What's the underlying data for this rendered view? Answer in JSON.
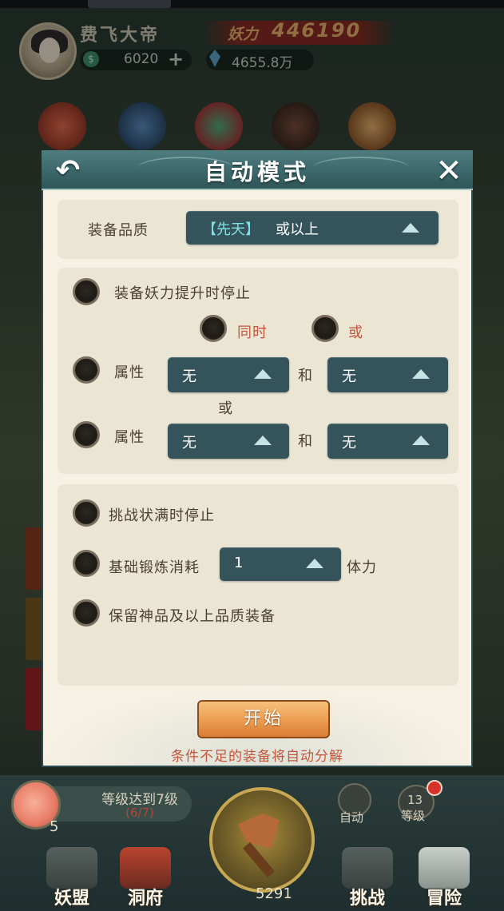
{
  "player": {
    "name": "费飞大帝",
    "power_label": "妖力",
    "power_value": "446190",
    "jade": "6020",
    "jade_plus": "+",
    "crystal": "4655.8万"
  },
  "modal": {
    "title": "自动模式",
    "back_icon": "back-arrow-icon",
    "close_icon": "close-x-icon",
    "quality": {
      "label": "装备品质",
      "selected_bracket": "【先天】",
      "selected_suffix": "或以上"
    },
    "stop_on_power": {
      "label": "装备妖力提升时停止",
      "mode_and": "同时",
      "mode_or": "或"
    },
    "attr_row_1": {
      "label": "属性",
      "first_value": "无",
      "joiner": "和",
      "second_value": "无"
    },
    "attr_or": "或",
    "attr_row_2": {
      "label": "属性",
      "first_value": "无",
      "joiner": "和",
      "second_value": "无"
    },
    "stop_on_challenge": "挑战状满时停止",
    "forge_cost": {
      "label": "基础锻炼消耗",
      "value": "1",
      "unit": "体力"
    },
    "keep_divine": "保留神品及以上品质装备",
    "start_button": "开始",
    "hint": "条件不足的装备将自动分解"
  },
  "bottom": {
    "level_goal": "等级达到7级",
    "level_progress": "(6/7)",
    "peach_count": "5",
    "auto_label": "自动",
    "level_num": "13",
    "level_label": "等级",
    "counter": "5291",
    "nav": [
      "妖盟",
      "洞府",
      "挑战",
      "冒险"
    ]
  },
  "colors": {
    "modal_bg": "#f6f1e3",
    "header_teal": "#3b6669",
    "dropdown": "#34535b",
    "accent_text": "#c4553c",
    "start_button": "#eda055"
  }
}
